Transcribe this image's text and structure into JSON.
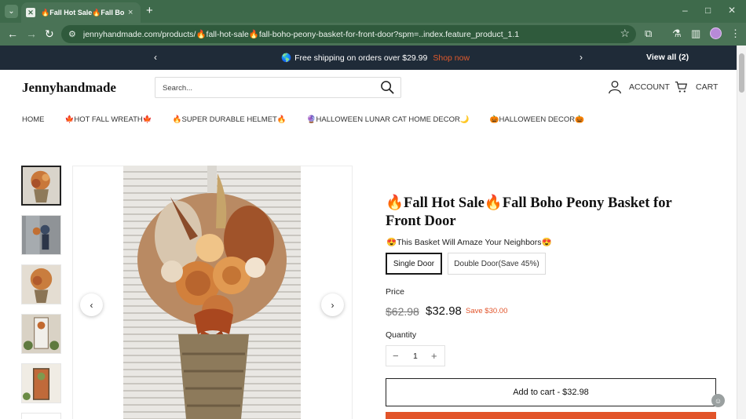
{
  "browser": {
    "tab_title": "🔥Fall Hot Sale🔥Fall Boho Pe",
    "tab_close": "×",
    "new_tab": "+",
    "url": "jennyhandmade.com/products/🔥fall-hot-sale🔥fall-boho-peony-basket-for-front-door?spm=..index.feature_product_1.1",
    "window": {
      "minimize": "–",
      "maximize": "□",
      "close": "✕"
    }
  },
  "announcement": {
    "icon": "🌎",
    "text": "Free shipping on orders over $29.99",
    "link": "Shop now",
    "view_all": "View all (2)",
    "prev": "‹",
    "next": "›"
  },
  "header": {
    "logo": "Jennyhandmade",
    "search_placeholder": "Search...",
    "account": "ACCOUNT",
    "cart": "CART"
  },
  "menu": [
    "HOME",
    "🍁HOT FALL WREATH🍁",
    "🔥SUPER DURABLE HELMET🔥",
    "🔮HALLOWEEN LUNAR CAT HOME DECOR🌙",
    "🎃HALLOWEEN DECOR🎃"
  ],
  "gallery": {
    "prev": "‹",
    "next": "›"
  },
  "product": {
    "title": "🔥Fall Hot Sale🔥Fall Boho Peony Basket for Front Door",
    "tagline": "😍This Basket Will Amaze Your Neighbors😍",
    "variants": [
      "Single Door",
      "Double Door(Save 45%)"
    ],
    "selected_variant": "Single Door",
    "price_label": "Price",
    "price_old": "$62.98",
    "price_new": "$32.98",
    "price_save": "Save $30.00",
    "qty_label": "Quantity",
    "qty_value": "1",
    "qty_minus": "−",
    "qty_plus": "+",
    "add_to_cart": "Add to cart - $32.98"
  },
  "colors": {
    "browser_frame": "#3e6a4b",
    "announcement_bg": "#1f2b38",
    "accent": "#e2542a"
  }
}
